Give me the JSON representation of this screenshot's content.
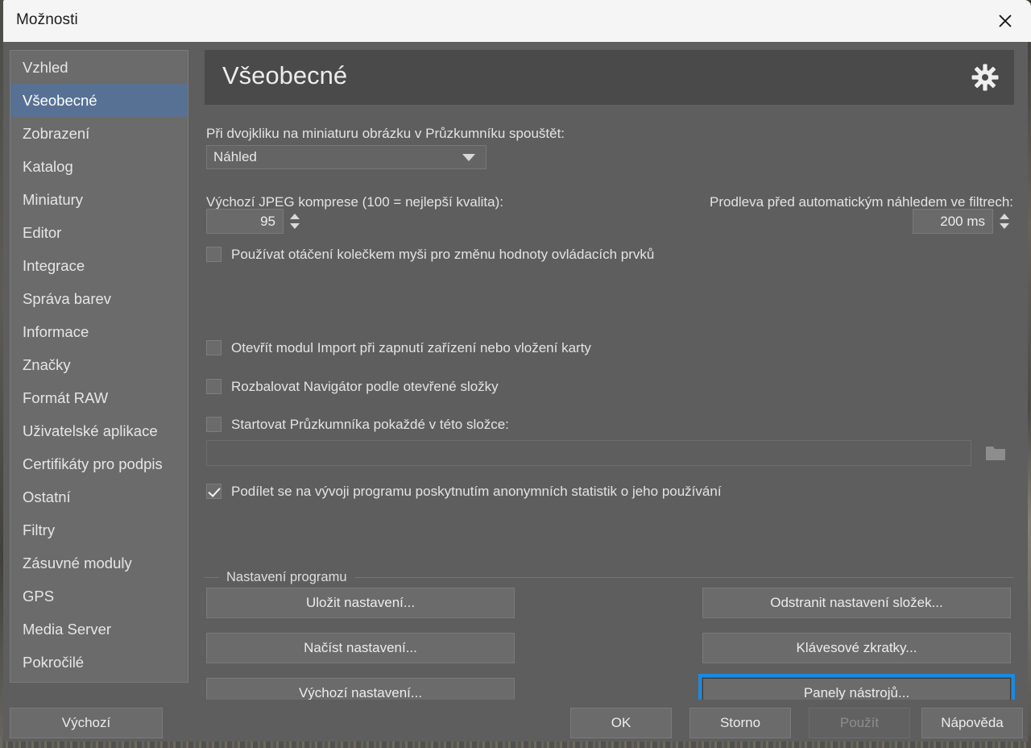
{
  "window": {
    "title": "Možnosti",
    "close_icon": "close-icon"
  },
  "sidebar": {
    "items": [
      {
        "label": "Vzhled",
        "selected": false
      },
      {
        "label": "Všeobecné",
        "selected": true
      },
      {
        "label": "Zobrazení",
        "selected": false
      },
      {
        "label": "Katalog",
        "selected": false
      },
      {
        "label": "Miniatury",
        "selected": false
      },
      {
        "label": "Editor",
        "selected": false
      },
      {
        "label": "Integrace",
        "selected": false
      },
      {
        "label": "Správa barev",
        "selected": false
      },
      {
        "label": "Informace",
        "selected": false
      },
      {
        "label": "Značky",
        "selected": false
      },
      {
        "label": "Formát RAW",
        "selected": false
      },
      {
        "label": "Uživatelské aplikace",
        "selected": false
      },
      {
        "label": "Certifikáty pro podpis",
        "selected": false
      },
      {
        "label": "Ostatní",
        "selected": false
      },
      {
        "label": "Filtry",
        "selected": false
      },
      {
        "label": "Zásuvné moduly",
        "selected": false
      },
      {
        "label": "GPS",
        "selected": false
      },
      {
        "label": "Media Server",
        "selected": false
      },
      {
        "label": "Pokročilé",
        "selected": false
      }
    ]
  },
  "header": {
    "title": "Všeobecné",
    "gear_icon": "gear-icon"
  },
  "main": {
    "doubleclick": {
      "label": "Při dvojkliku na miniaturu obrázku v Průzkumníku spouštět:",
      "value": "Náhled"
    },
    "jpeg": {
      "label": "Výchozí JPEG komprese (100 = nejlepší kvalita):",
      "value": "95"
    },
    "preview_delay": {
      "label": "Prodleva před automatickým náhledem ve filtrech:",
      "value": "200 ms"
    },
    "checkboxes": [
      {
        "label": "Používat otáčení kolečkem myši pro změnu hodnoty ovládacích prvků",
        "checked": false
      },
      {
        "label": "Otevřít modul Import při zapnutí zařízení nebo vložení karty",
        "checked": false
      },
      {
        "label": "Rozbalovat Navigátor podle otevřené složky",
        "checked": false
      },
      {
        "label": "Startovat Průzkumníka pokaždé v této složce:",
        "checked": false
      },
      {
        "label": "Podílet se na vývoji programu poskytnutím anonymních statistik o jeho používání",
        "checked": true
      }
    ],
    "folder_path": {
      "value": "",
      "browse_icon": "folder-icon"
    },
    "group": {
      "title": "Nastavení programu",
      "buttons_left": [
        "Uložit nastavení...",
        "Načíst nastavení...",
        "Výchozí nastavení..."
      ],
      "buttons_right": [
        {
          "label": "Odstranit nastavení složek...",
          "focused": false
        },
        {
          "label": "Klávesové zkratky...",
          "focused": false
        },
        {
          "label": "Panely nástrojů...",
          "focused": true
        }
      ]
    }
  },
  "footer": {
    "defaults": "Výchozí",
    "ok": "OK",
    "cancel": "Storno",
    "apply": "Použít",
    "help": "Nápověda",
    "apply_disabled": true
  },
  "colors": {
    "dialog_bg": "#5e5e5e",
    "sidebar_bg": "#6b6b6b",
    "selection": "#577194",
    "header_panel": "#4a4a4a",
    "titlebar": "#f5f5f5",
    "focus_ring": "#1a8ae0"
  }
}
